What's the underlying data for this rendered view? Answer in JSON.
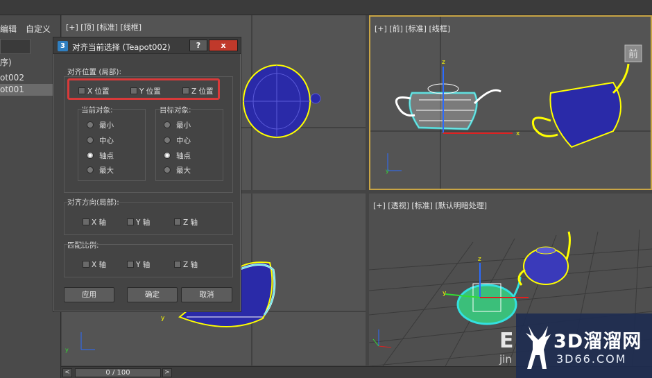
{
  "menu": {
    "edit": "编辑",
    "customize": "自定义"
  },
  "left_panel": {
    "header_fragment": "序)",
    "item1": "ot002",
    "item2": "ot001"
  },
  "viewports": {
    "top": "[+] [顶] [标准] [线框]",
    "front": "[+] [前] [标准] [线框]",
    "perspective": "[+] [透视] [标准] [默认明暗处理]",
    "front_cube_label": "前"
  },
  "dialog": {
    "app_icon": "3",
    "title": "对齐当前选择 (Teapot002)",
    "help_btn": "?",
    "close_btn": "x",
    "align_position": {
      "label": "对齐位置 (局部):",
      "x": "X 位置",
      "y": "Y 位置",
      "z": "Z 位置"
    },
    "current_object": {
      "label": "当前对象:",
      "options": [
        "最小",
        "中心",
        "轴点",
        "最大"
      ],
      "selected": "轴点"
    },
    "target_object": {
      "label": "目标对象:",
      "options": [
        "最小",
        "中心",
        "轴点",
        "最大"
      ],
      "selected": "轴点"
    },
    "align_orientation": {
      "label": "对齐方向(局部):",
      "x": "X 轴",
      "y": "Y 轴",
      "z": "Z 轴"
    },
    "match_scale": {
      "label": "匹配比例:",
      "x": "X 轴",
      "y": "Y 轴",
      "z": "Z 轴"
    },
    "buttons": {
      "apply": "应用",
      "ok": "确定",
      "cancel": "取消"
    }
  },
  "axes": {
    "x": "x",
    "y": "y",
    "z": "z"
  },
  "timeline": {
    "frame": "0 / 100",
    "prev": "<",
    "next": ">"
  },
  "watermark": {
    "brand": "3D溜溜网",
    "url": "3D66.COM",
    "logo_letter": "E",
    "logo_fragment": "jin"
  },
  "colors": {
    "selection": "#ffff00",
    "teapot": "#2a2aa8",
    "highlight_red": "#d83a3a",
    "active_viewport": "#c9a545"
  }
}
